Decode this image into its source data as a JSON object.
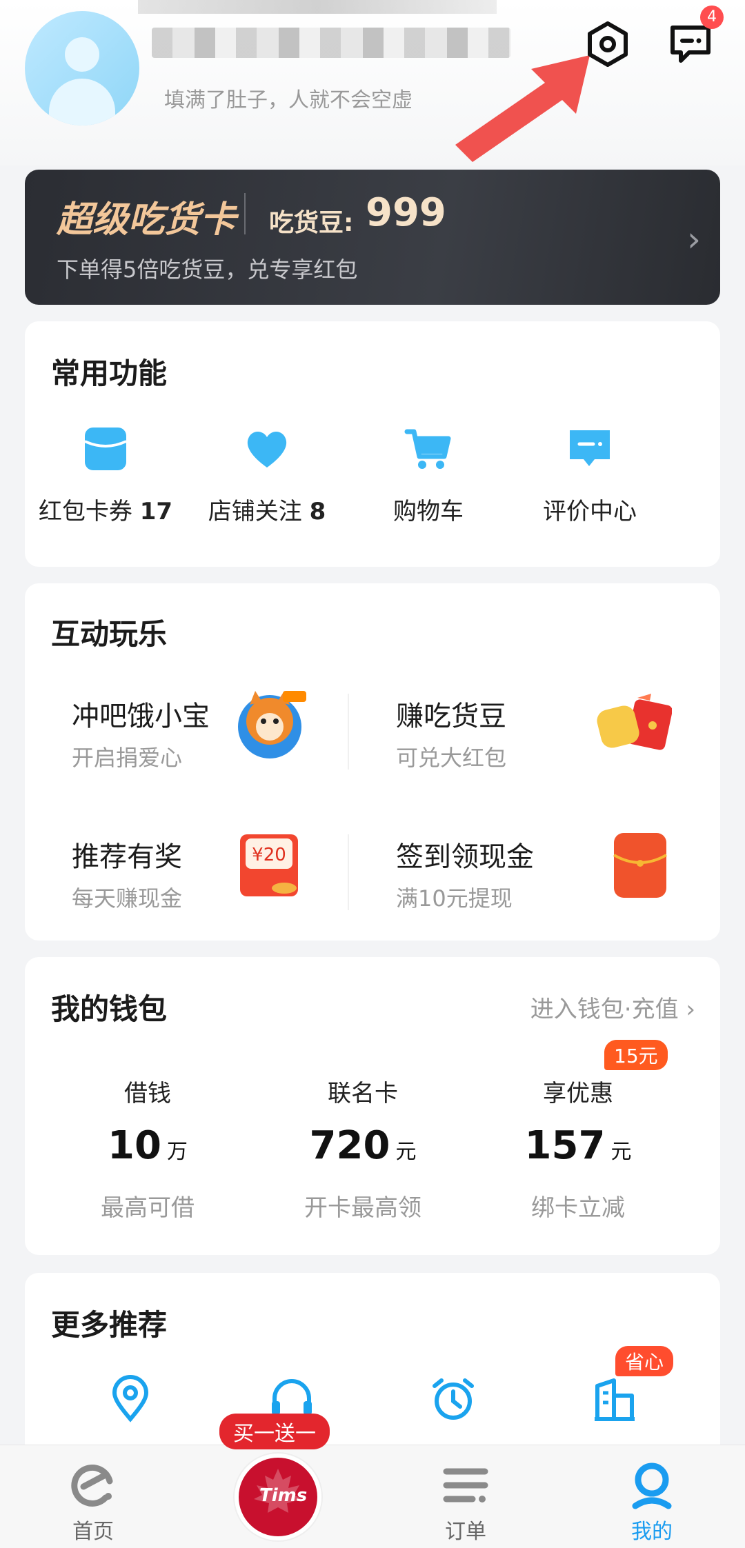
{
  "profile": {
    "motto": "填满了肚子，人就不会空虚"
  },
  "header": {
    "message_badge": "4"
  },
  "vip": {
    "title": "超级吃货卡",
    "beans_label": "吃货豆:",
    "beans_value": "999",
    "subtitle": "下单得5倍吃货豆，兑专享红包"
  },
  "common": {
    "title": "常用功能",
    "items": [
      {
        "label": "红包卡券",
        "count": "17",
        "icon": "coupon-icon"
      },
      {
        "label": "店铺关注",
        "count": "8",
        "icon": "heart-icon"
      },
      {
        "label": "购物车",
        "count": "",
        "icon": "cart-icon"
      },
      {
        "label": "评价中心",
        "count": "",
        "icon": "review-icon"
      }
    ]
  },
  "fun": {
    "title": "互动玩乐",
    "items": [
      {
        "title": "冲吧饿小宝",
        "subtitle": "开启捐爱心",
        "icon": "mascot-icon"
      },
      {
        "title": "赚吃货豆",
        "subtitle": "可兑大红包",
        "icon": "beans-redpacket-icon"
      },
      {
        "title": "推荐有奖",
        "subtitle": "每天赚现金",
        "icon": "cash-reward-icon",
        "badge": "¥20"
      },
      {
        "title": "签到领现金",
        "subtitle": "满10元提现",
        "icon": "red-envelope-icon"
      }
    ]
  },
  "wallet": {
    "title": "我的钱包",
    "link": "进入钱包·充值",
    "promo_tag": "15元",
    "items": [
      {
        "head": "借钱",
        "value": "10",
        "unit": "万",
        "foot": "最高可借"
      },
      {
        "head": "联名卡",
        "value": "720",
        "unit": "元",
        "foot": "开卡最高领"
      },
      {
        "head": "享优惠",
        "value": "157",
        "unit": "元",
        "foot": "绑卡立减"
      }
    ]
  },
  "more": {
    "title": "更多推荐",
    "tag": "省心",
    "icons": [
      "location-icon",
      "headset-icon",
      "alarm-icon",
      "building-icon"
    ]
  },
  "tabbar": {
    "promo": "买一送一",
    "tims": "Tims",
    "tabs": [
      {
        "label": "首页",
        "active": false
      },
      {
        "label": "订单",
        "active": false
      },
      {
        "label": "我的",
        "active": true
      }
    ]
  },
  "colors": {
    "accent": "#1a9cf0",
    "badge": "#ff4d4f",
    "vip_gold": "#f3c79a"
  }
}
